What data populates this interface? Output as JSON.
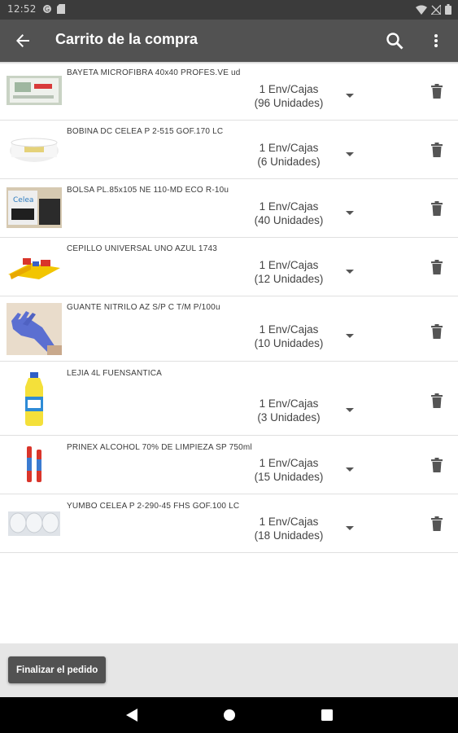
{
  "status_bar": {
    "time": "12:52",
    "icons_left": [
      "sync-icon",
      "sd-card-icon"
    ],
    "icons_right": [
      "wifi-icon",
      "signal-off-icon",
      "battery-icon"
    ]
  },
  "app_bar": {
    "title": "Carrito de la compra",
    "back_icon": "arrow-back-icon",
    "search_icon": "search-icon",
    "more_icon": "more-vert-icon"
  },
  "cart": {
    "items": [
      {
        "name": "BAYETA MICROFIBRA 40x40 PROFES.VE ud",
        "qty": "1 Env/Cajas",
        "units": "(96 Unidades)",
        "image": "cloth-pack"
      },
      {
        "name": "BOBINA DC CELEA P 2-515 GOF.170 LC",
        "qty": "1 Env/Cajas",
        "units": "(6 Unidades)",
        "image": "paper-rolls"
      },
      {
        "name": "BOLSA PL.85x105 NE 110-MD ECO R-10u",
        "qty": "1 Env/Cajas",
        "units": "(40 Unidades)",
        "image": "trash-bags"
      },
      {
        "name": "CEPILLO UNIVERSAL UNO AZUL 1743",
        "qty": "1 Env/Cajas",
        "units": "(12 Unidades)",
        "image": "brushes"
      },
      {
        "name": "GUANTE NITRILO AZ S/P C T/M P/100u",
        "qty": "1 Env/Cajas",
        "units": "(10 Unidades)",
        "image": "glove"
      },
      {
        "name": "LEJIA 4L FUENSANTICA",
        "qty": "1 Env/Cajas",
        "units": "(3 Unidades)",
        "image": "bleach-bottle"
      },
      {
        "name": "PRINEX ALCOHOL 70% DE LIMPIEZA SP 750ml",
        "qty": "1 Env/Cajas",
        "units": "(15 Unidades)",
        "image": "spray-bottles"
      },
      {
        "name": "YUMBO CELEA P 2-290-45 FHS GOF.100 LC",
        "qty": "1 Env/Cajas",
        "units": "(18 Unidades)",
        "image": "jumbo-rolls"
      }
    ]
  },
  "footer": {
    "finish_label": "Finalizar el pedido"
  },
  "nav_bar": {
    "icons": [
      "back-triangle-icon",
      "home-circle-icon",
      "recents-square-icon"
    ]
  },
  "colors": {
    "app_bar": "#525252",
    "status_bar": "#3b3b3b",
    "footer": "#e6e6e6",
    "button": "#525252"
  }
}
